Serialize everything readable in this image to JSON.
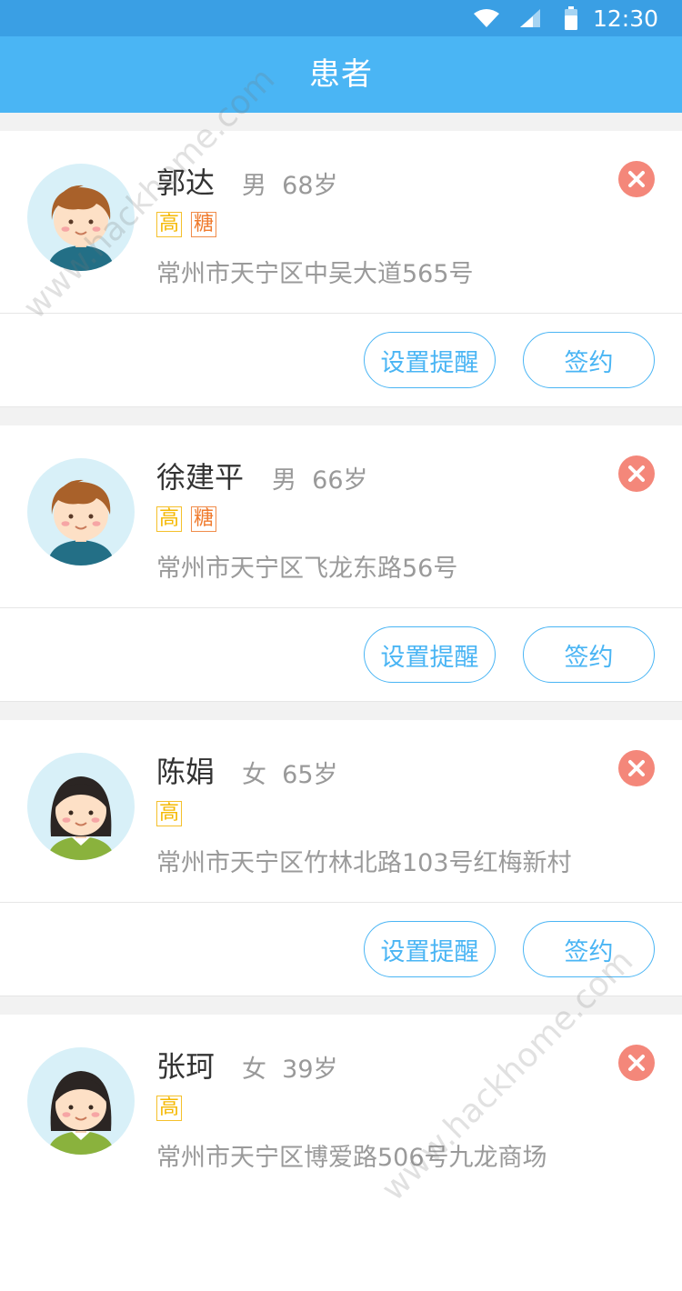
{
  "status_bar": {
    "time": "12:30"
  },
  "header": {
    "title": "患者"
  },
  "patients": [
    {
      "name": "郭达",
      "gender": "男",
      "age": "68岁",
      "tags": [
        "高",
        "糖"
      ],
      "address": "常州市天宁区中吴大道565号",
      "avatar": "boy-avatar"
    },
    {
      "name": "徐建平",
      "gender": "男",
      "age": "66岁",
      "tags": [
        "高",
        "糖"
      ],
      "address": "常州市天宁区飞龙东路56号",
      "avatar": "boy-avatar"
    },
    {
      "name": "陈娟",
      "gender": "女",
      "age": "65岁",
      "tags": [
        "高"
      ],
      "address": "常州市天宁区竹林北路103号红梅新村",
      "avatar": "girl-avatar"
    },
    {
      "name": "张珂",
      "gender": "女",
      "age": "39岁",
      "tags": [
        "高"
      ],
      "address": "常州市天宁区博爱路506号九龙商场",
      "avatar": "girl-avatar"
    }
  ],
  "actions": {
    "remind_label": "设置提醒",
    "sign_label": "签约"
  },
  "watermark": "www.hackhome.com",
  "colors": {
    "header": "#4ab5f4",
    "status_bar": "#3a9fe4",
    "remove": "#f4877a",
    "tag_gao": "#f5b800",
    "tag_tang": "#f07b2e"
  }
}
